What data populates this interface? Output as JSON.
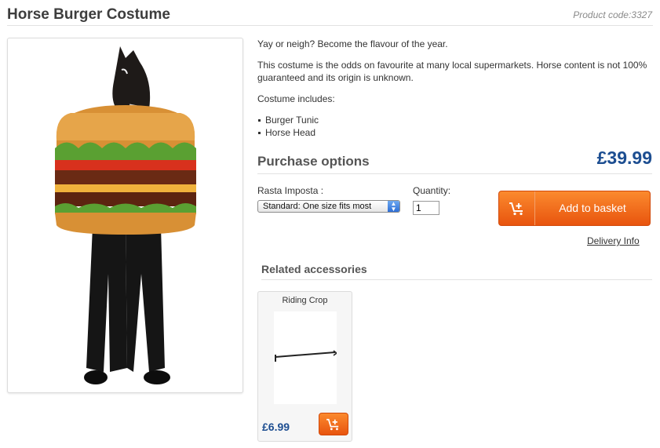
{
  "product": {
    "title": "Horse Burger Costume",
    "code": "Product code:3327",
    "image_alt": "costume-photo"
  },
  "description": {
    "tagline": "Yay or neigh? Become the flavour of the year.",
    "body": "This costume is the odds on favourite at many local supermarkets. Horse content is not 100% guaranteed and its origin is unknown.",
    "includes_label": "Costume includes:",
    "includes": [
      "Burger Tunic",
      "Horse Head"
    ]
  },
  "purchase": {
    "heading": "Purchase options",
    "price": "£39.99",
    "option_label": "Rasta Imposta :",
    "option_value": "Standard: One size fits most",
    "quantity_label": "Quantity:",
    "quantity_value": "1",
    "add_label": "Add to basket",
    "delivery_label": "Delivery Info"
  },
  "related": {
    "heading": "Related accessories",
    "items": [
      {
        "name": "Riding Crop",
        "price": "£6.99"
      }
    ]
  },
  "colors": {
    "accent": "#f06a1c",
    "price": "#1d4e91"
  },
  "icons": {
    "basket": "add-to-cart-icon",
    "select_arrow": "select-arrows-icon"
  }
}
